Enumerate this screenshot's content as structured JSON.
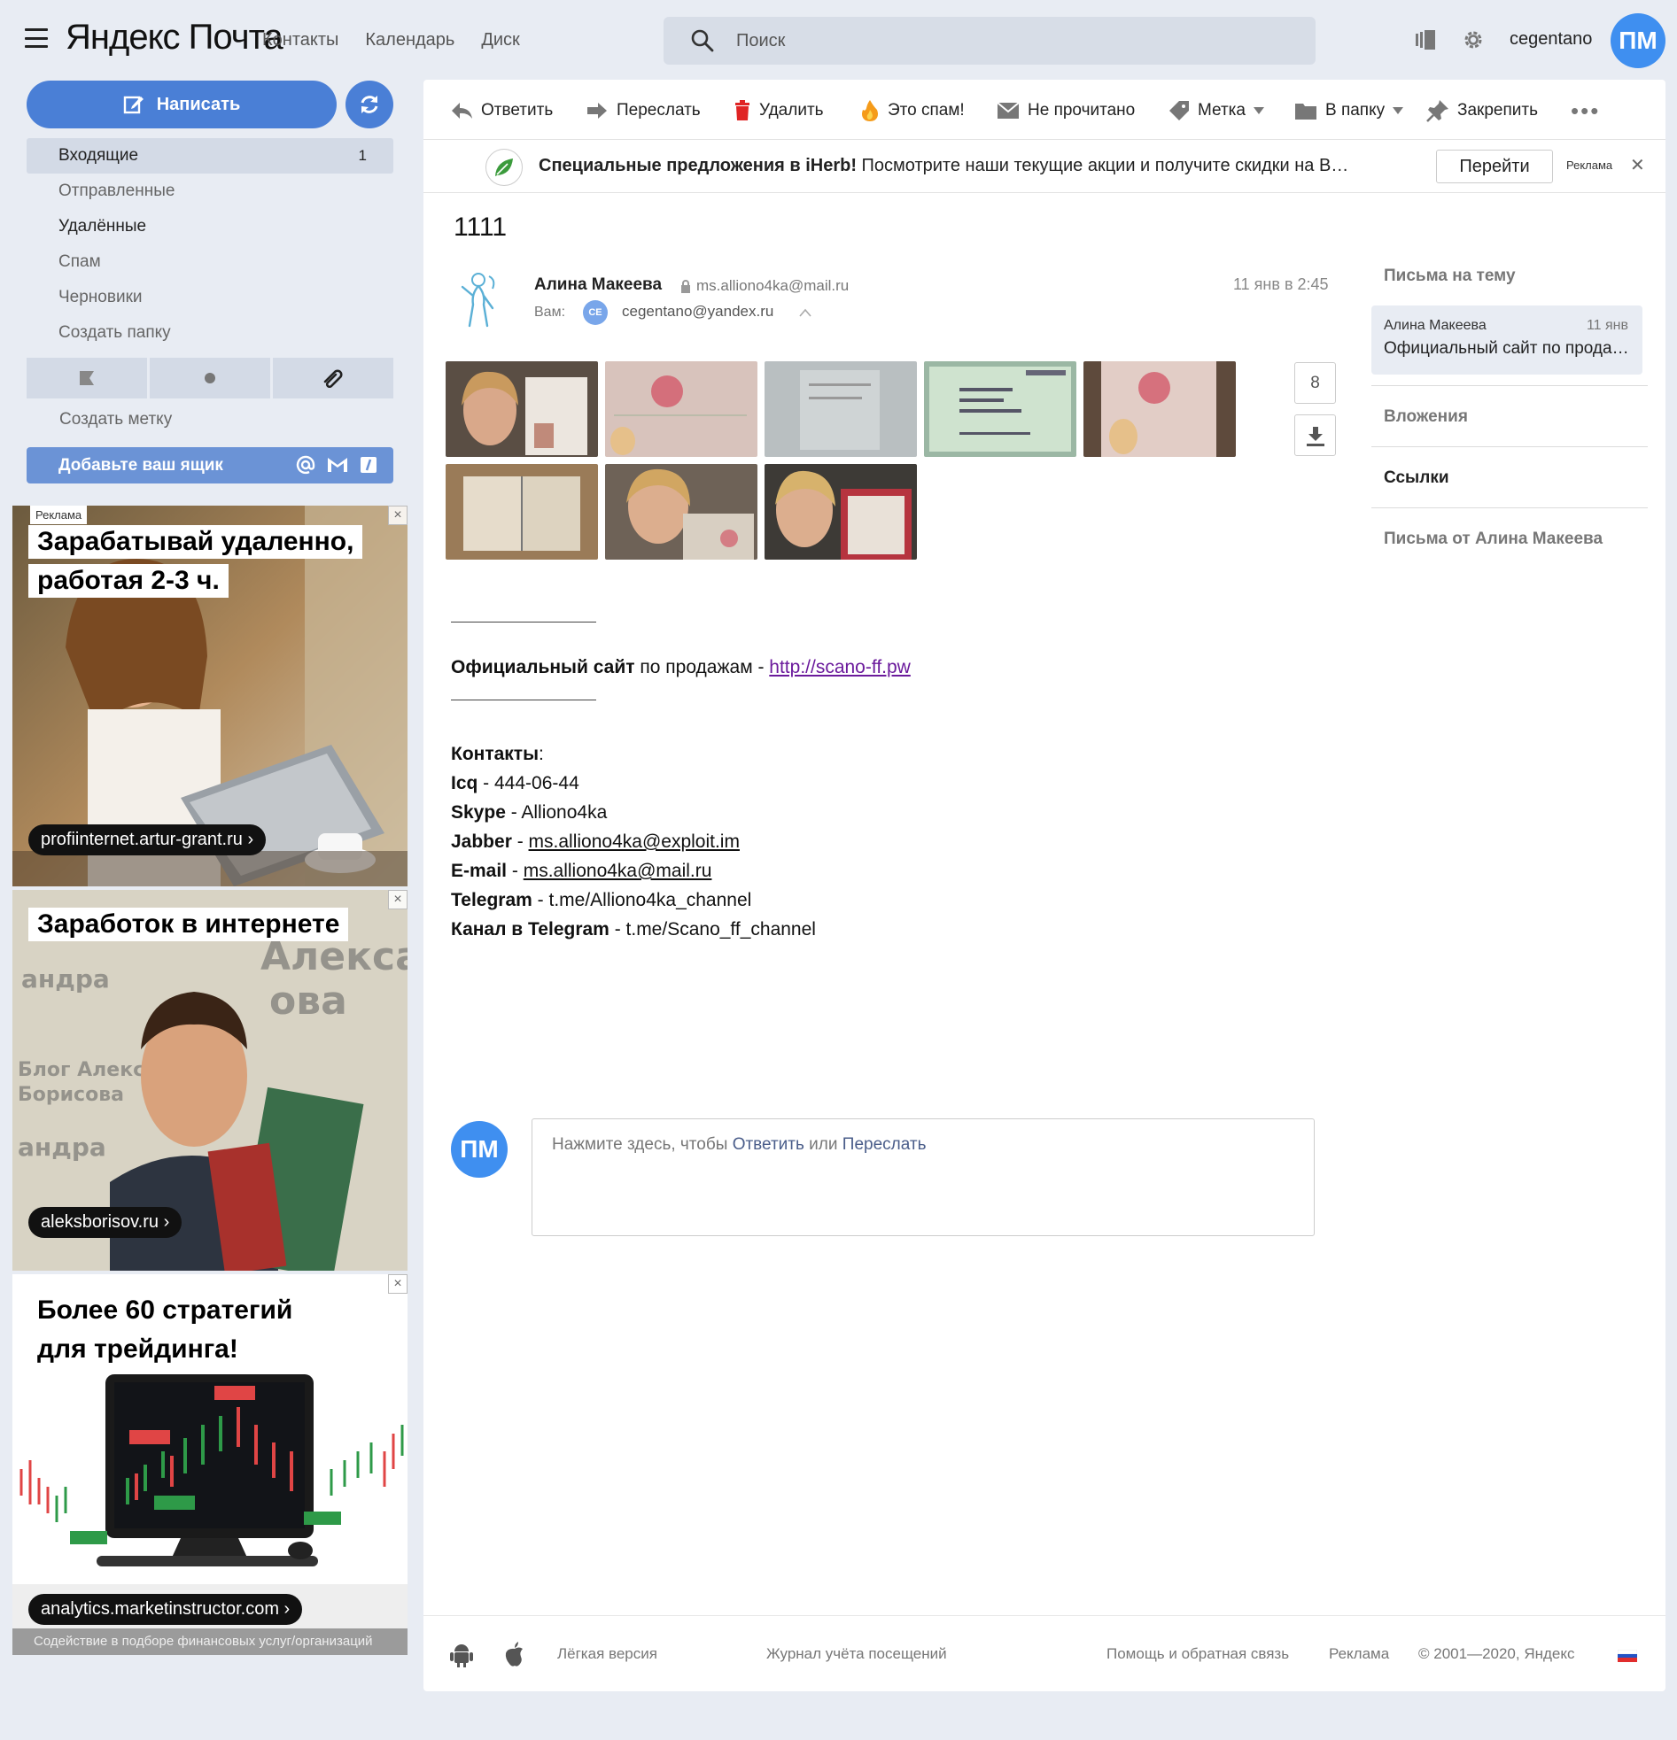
{
  "header": {
    "logo_brand": "Яндекс",
    "logo_product": "Почта",
    "nav": [
      "Контакты",
      "Календарь",
      "Диск"
    ],
    "search_placeholder": "Поиск",
    "username": "cegentano",
    "avatar_initials": "ПМ"
  },
  "sidebar": {
    "compose_label": "Написать",
    "folders": [
      {
        "label": "Входящие",
        "count": "1"
      },
      {
        "label": "Отправленные"
      },
      {
        "label": "Удалённые"
      },
      {
        "label": "Спам"
      },
      {
        "label": "Черновики"
      },
      {
        "label": "Создать папку"
      }
    ],
    "create_label": "Создать метку",
    "add_mailbox": "Добавьте ваш ящик"
  },
  "ads": [
    {
      "tag": "Реклама",
      "headline": [
        "Зарабатывай удаленно,",
        "работая 2-3 ч."
      ],
      "domain": "profiinternet.artur-grant.ru ›"
    },
    {
      "headline": [
        "Заработок в интернете"
      ],
      "domain": "aleksborisov.ru ›"
    },
    {
      "headline": [
        "Более 60 стратегий",
        "для трейдинга!"
      ],
      "domain": "analytics.marketinstructor.com ›",
      "disclaimer": "Содействие в подборе финансовых услуг/организаций"
    }
  ],
  "toolbar": {
    "reply": "Ответить",
    "forward": "Переслать",
    "delete": "Удалить",
    "spam": "Это спам!",
    "unread": "Не прочитано",
    "label": "Метка",
    "to_folder": "В папку",
    "pin": "Закрепить"
  },
  "adbar": {
    "bold": "Специальные предложения в iHerb!",
    "text": " Посмотрите наши текущие акции и получите скидки на В…",
    "button": "Перейти",
    "ad_label": "Реклама"
  },
  "message": {
    "subject": "1111",
    "sender_name": "Алина Макеева",
    "sender_email": "ms.alliono4ka@mail.ru",
    "to_label": "Вам:",
    "to_badge": "CE",
    "to_email": "cegentano@yandex.ru",
    "date": "11 янв в 2:45",
    "attachments_count": "8"
  },
  "body": {
    "site_bold": "Официальный сайт",
    "site_text": " по продажам - ",
    "site_link": "http://scano-ff.pw",
    "contacts_bold": "Контакты",
    "contacts_colon": ":",
    "lines": [
      {
        "k": "Icq",
        "v": " - 444-06-44"
      },
      {
        "k": "Skype",
        "v": " - Alliono4ka"
      },
      {
        "k": "Jabber",
        "sep": " - ",
        "link": "ms.alliono4ka@exploit.im"
      },
      {
        "k": "E-mail",
        "sep": " - ",
        "link": "ms.alliono4ka@mail.ru"
      },
      {
        "k": "Telegram",
        "v": " - t.me/Alliono4ka_channel"
      },
      {
        "k": "Канал в Telegram",
        "v": " - t.me/Scano_ff_channel"
      }
    ]
  },
  "reply": {
    "avatar": "ПМ",
    "prefix": "Нажмите здесь, чтобы ",
    "reply_link": "Ответить",
    "or": " или ",
    "forward_link": "Переслать"
  },
  "right_panel": {
    "thread_title": "Письма на тему",
    "thread_item": {
      "name": "Алина Макеева",
      "date": "11 янв",
      "subject": "Официальный сайт по продажам"
    },
    "attachments": "Вложения",
    "links": "Ссылки",
    "from_sender": "Письма от Алина Макеева"
  },
  "footer": {
    "lite": "Лёгкая версия",
    "journal": "Журнал учёта посещений",
    "help": "Помощь и обратная связь",
    "ads": "Реклама",
    "copyright": "© 2001—2020, Яндекс"
  },
  "colors": {
    "accent": "#4a7fd6",
    "avatar": "#3f8ff0",
    "background": "#e8ecf3",
    "link_purple": "#6b1a9c"
  }
}
